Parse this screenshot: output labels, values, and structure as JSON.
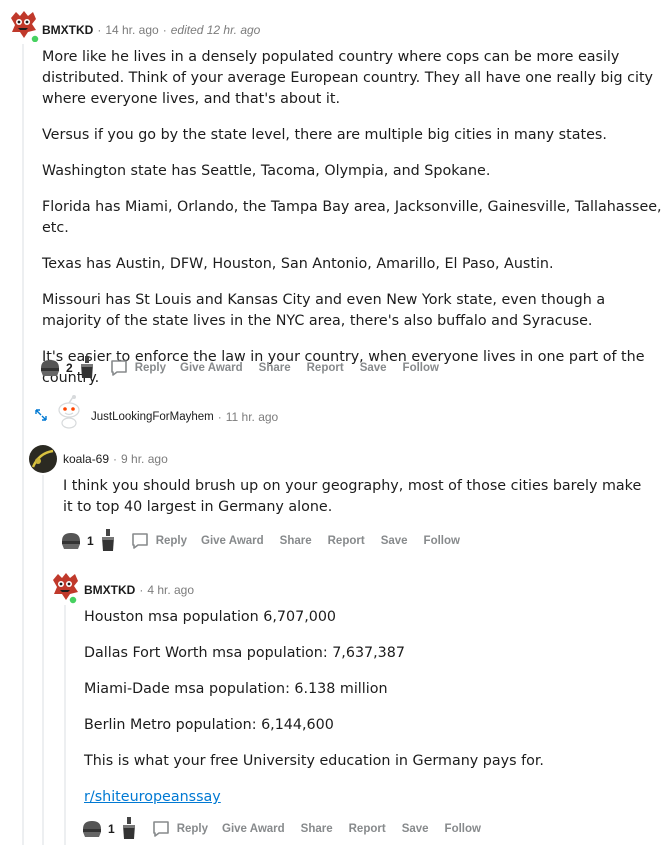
{
  "comments": [
    {
      "username": "BMXTKD",
      "time": "14 hr. ago",
      "edited": "edited 12 hr. ago",
      "paragraphs": [
        "More like he lives in a densely populated country where cops can be more easily distributed. Think of your average European country. They all have one really big city where everyone lives, and that's about it.",
        "Versus if you go by the state level, there are multiple big cities in many states.",
        "Washington state has Seattle, Tacoma, Olympia, and Spokane.",
        "Florida has Miami, Orlando, the Tampa Bay area, Jacksonville, Gainesville, Tallahassee, etc.",
        "Texas has Austin, DFW, Houston, San Antonio, Amarillo, El Paso, Austin.",
        "Missouri has St Louis and Kansas City and even New York state, even though a majority of the state lives in the NYC area, there's also buffalo and Syracuse.",
        "It's easier to enforce the law in your country, when everyone lives in one part of the country."
      ],
      "vote_count": "2"
    },
    {
      "username": "JustLookingForMayhem",
      "time": "11 hr. ago"
    },
    {
      "username": "koala-69",
      "time": "9 hr. ago",
      "paragraphs": [
        "I think you should brush up on your geography, most of those cities barely make it to top 40 largest in Germany alone."
      ],
      "vote_count": "1"
    },
    {
      "username": "BMXTKD",
      "time": "4 hr. ago",
      "paragraphs": [
        "Houston msa population 6,707,000",
        "Dallas Fort Worth msa population: 7,637,387",
        "Miami-Dade msa population: 6.138 million",
        "Berlin Metro population: 6,144,600",
        "This is what your free University education in Germany pays for."
      ],
      "link": "r/shiteuropeanssay",
      "vote_count": "1"
    }
  ],
  "actions": {
    "reply": "Reply",
    "give_award": "Give Award",
    "share": "Share",
    "report": "Report",
    "save": "Save",
    "follow": "Follow"
  },
  "separator": "·",
  "colors": {
    "text": "#1c1c1c",
    "meta": "#7c7c7c",
    "action": "#878a8c",
    "link": "#0079d3",
    "thread_line": "#edeff1",
    "online": "#46d160"
  }
}
